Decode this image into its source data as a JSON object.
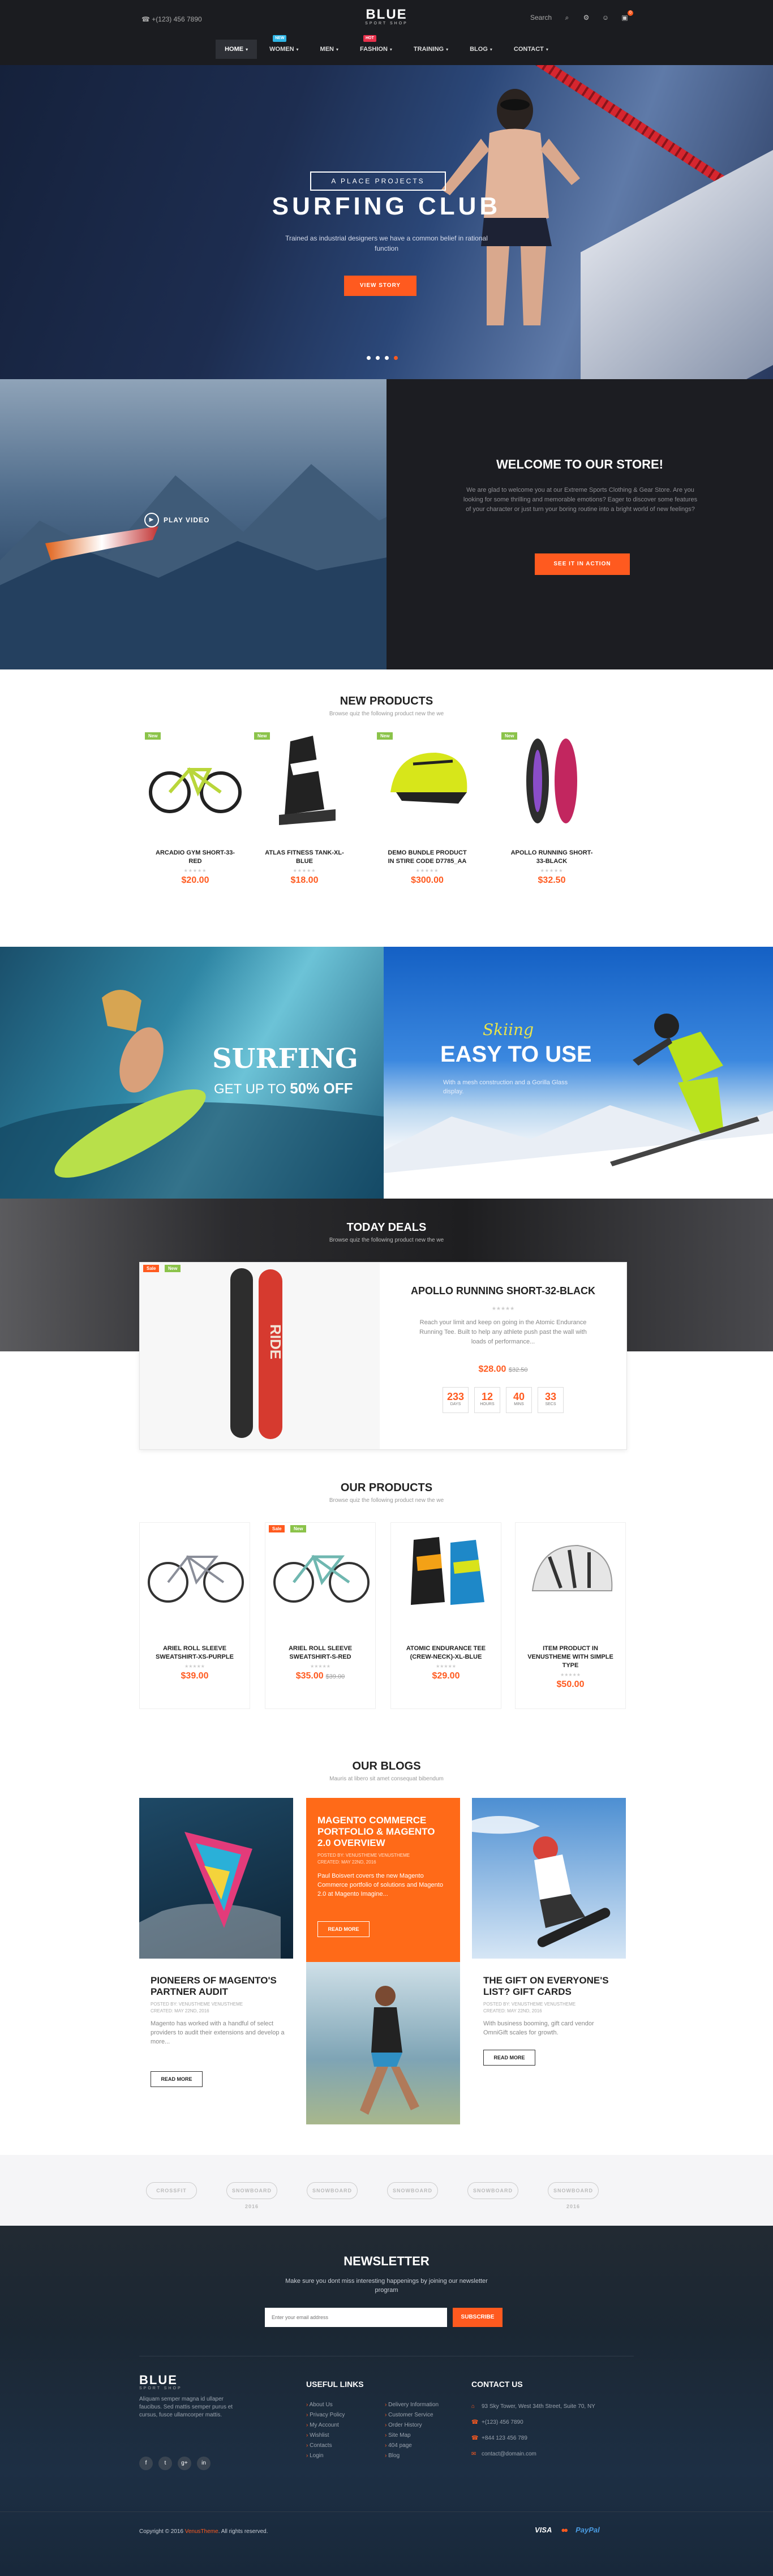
{
  "header": {
    "phone": "+(123) 456 7890",
    "logo_main": "BLUE",
    "logo_sub": "SPORT SHOP",
    "search_label": "Search",
    "cart_count": "0"
  },
  "nav": [
    {
      "label": "HOME",
      "arrow": "▾"
    },
    {
      "label": "WOMEN",
      "arrow": "▾",
      "badge": "NEW",
      "badge_color": "#2fb6e6"
    },
    {
      "label": "MEN",
      "arrow": "▾"
    },
    {
      "label": "FASHION",
      "arrow": "▾",
      "badge": "HOT",
      "badge_color": "#e8304b"
    },
    {
      "label": "TRAINING",
      "arrow": "▾"
    },
    {
      "label": "BLOG",
      "arrow": "▾"
    },
    {
      "label": "CONTACT",
      "arrow": "▾"
    }
  ],
  "hero": {
    "tag": "A PLACE PROJECTS",
    "title": "SURFING CLUB",
    "subtitle": "Trained as industrial designers we have a common belief in rational function",
    "button": "VIEW STORY"
  },
  "video": {
    "label": "PLAY VIDEO"
  },
  "welcome": {
    "title": "WELCOME TO OUR STORE!",
    "text": "We are glad to welcome you at our Extreme Sports Clothing & Gear Store. Are you looking for some thrilling and memorable emotions? Eager to discover some features of your character or just turn your boring routine into a bright world of new feelings?",
    "button": "SEE IT IN ACTION"
  },
  "new_products": {
    "title": "NEW PRODUCTS",
    "subtitle": "Browse quiz the following product new the we",
    "items": [
      {
        "badge": "New",
        "name": "ARCADIO GYM SHORT-33-RED",
        "price": "$20.00"
      },
      {
        "badge": "New",
        "name": "ATLAS FITNESS TANK-XL-BLUE",
        "price": "$18.00"
      },
      {
        "badge": "New",
        "name": "DEMO BUNDLE PRODUCT IN STIRE CODE D7785_AA",
        "price": "$300.00"
      },
      {
        "badge": "New",
        "name": "APOLLO RUNNING SHORT-33-BLACK",
        "price": "$32.50"
      }
    ]
  },
  "banners": {
    "surf_title": "SURFING",
    "surf_sub_prefix": "GET UP TO",
    "surf_sub_value": "50% OFF",
    "ski_script": "Skiing",
    "ski_title": "EASY TO USE",
    "ski_text": "With a mesh construction and a Gorilla Glass display."
  },
  "deals": {
    "title": "TODAY DEALS",
    "subtitle": "Browse quiz the following product new the we",
    "badge_sale": "Sale",
    "badge_new": "New",
    "name": "APOLLO RUNNING SHORT-32-BLACK",
    "desc": "Reach your limit and keep on going in the Atomic Endurance Running Tee. Built to help any athlete push past the wall with loads of performance...",
    "price": "$28.00",
    "old_price": "$32.50",
    "board_text": "RIDE",
    "timer": [
      {
        "n": "233",
        "u": "DAYS"
      },
      {
        "n": "12",
        "u": "HOURS"
      },
      {
        "n": "40",
        "u": "MINS"
      },
      {
        "n": "33",
        "u": "SECS"
      }
    ]
  },
  "our_products": {
    "title": "OUR PRODUCTS",
    "subtitle": "Browse quiz the following product new the we",
    "items": [
      {
        "name": "ARIEL ROLL SLEEVE SWEATSHIRT-XS-PURPLE",
        "price": "$39.00",
        "old": ""
      },
      {
        "name": "ARIEL ROLL SLEEVE SWEATSHIRT-S-RED",
        "price": "$35.00",
        "old": "$39.00",
        "sale": "Sale",
        "new": "New"
      },
      {
        "name": "ATOMIC ENDURANCE TEE (CREW-NECK)-XL-BLUE",
        "price": "$29.00",
        "old": ""
      },
      {
        "name": "ITEM PRODUCT IN VENUSTHEME WITH SIMPLE TYPE",
        "price": "$50.00",
        "old": ""
      }
    ]
  },
  "stars": "★★★★★",
  "blogs": {
    "title": "OUR BLOGS",
    "subtitle": "Mauris at libero sit amet consequat bibendum",
    "items": [
      {
        "title": "PIONEERS OF MAGENTO'S PARTNER AUDIT",
        "meta1": "POSTED BY: VENUSTHEME VENUSTHEME",
        "meta2": "CREATED: MAY 22ND, 2016",
        "text": "Magento has worked with a handful of select providers to audit their extensions and develop a more...",
        "button": "READ MORE"
      },
      {
        "title": "MAGENTO COMMERCE PORTFOLIO & MAGENTO 2.0 OVERVIEW",
        "meta1": "POSTED BY: VENUSTHEME VENUSTHEME",
        "meta2": "CREATED: MAY 22ND, 2016",
        "text": "Paul Boisvert covers the new Magento Commerce portfolio of solutions and Magento 2.0 at Magento Imagine...",
        "button": "READ MORE"
      },
      {
        "title": "THE GIFT ON EVERYONE'S LIST? GIFT CARDS",
        "meta1": "POSTED BY: VENUSTHEME VENUSTHEME",
        "meta2": "CREATED: MAY 22ND, 2016",
        "text": "With business booming, gift card vendor OmniGift scales for growth.",
        "button": "READ MORE"
      }
    ]
  },
  "brands": [
    "CROSSFIT",
    "SNOWBOARD 2016",
    "SNOWBOARD",
    "SNOWBOARD",
    "SNOWBOARD",
    "SNOWBOARD 2016"
  ],
  "newsletter": {
    "title": "NEWSLETTER",
    "text": "Make sure you dont miss interesting happenings by joining our newsletter program",
    "placeholder": "Enter your email address",
    "button": "SUBSCRIBE"
  },
  "footer": {
    "logo": "BLUE",
    "logo_sub": "SPORT SHOP",
    "about": "Aliquam semper magna id ullaper faucibus. Sed mattis semper purus et cursus, fusce ullamcorper mattis.",
    "social": [
      "f",
      "t",
      "g+",
      "in"
    ],
    "links_title": "USEFUL LINKS",
    "links_col1": [
      "About Us",
      "Privacy Policy",
      "My Account",
      "Wishlist",
      "Contacts",
      "Login"
    ],
    "links_col2": [
      "Delivery Information",
      "Customer Service",
      "Order History",
      "Site Map",
      "404 page",
      "Blog"
    ],
    "contact_title": "CONTACT US",
    "contact": [
      "93 Sky Tower, West 34th Street, Suite 70, NY",
      "+(123) 456 7890",
      "+844 123 456 789",
      "contact@domain.com"
    ],
    "copyright_prefix": "Copyright © 2016",
    "copyright_brand": "VenusTheme",
    "copyright_suffix": ". All rights reserved.",
    "pay": [
      "VISA",
      "●●",
      "PayPal"
    ]
  }
}
